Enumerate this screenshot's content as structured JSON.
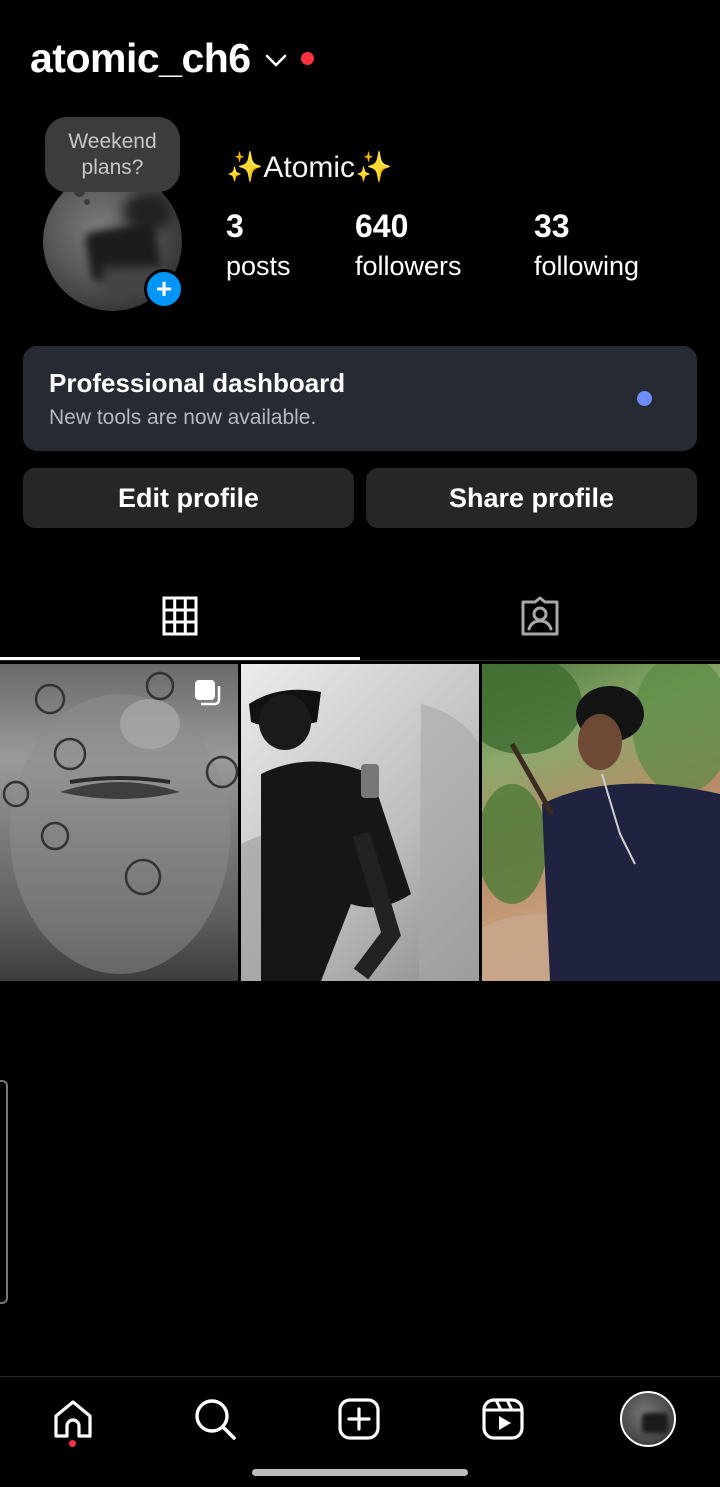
{
  "profile": {
    "username": "atomic_ch6",
    "display_name": "✨Atomic✨",
    "note_bubble": {
      "line1": "Weekend",
      "line2": "plans?"
    },
    "add_story_symbol": "+"
  },
  "stats": {
    "posts": {
      "value": "3",
      "label": "posts"
    },
    "followers": {
      "value": "640",
      "label": "followers"
    },
    "following": {
      "value": "33",
      "label": "following"
    }
  },
  "dashboard": {
    "title": "Professional dashboard",
    "subtitle": "New tools are now available."
  },
  "buttons": {
    "edit": "Edit profile",
    "share": "Share profile"
  },
  "tabs": [
    {
      "name": "grid",
      "icon": "grid-icon",
      "active": true
    },
    {
      "name": "tagged",
      "icon": "tagged-icon",
      "active": false
    }
  ],
  "posts": [
    {
      "type": "carousel",
      "icon": "multiple-images-icon"
    },
    {
      "type": "single"
    },
    {
      "type": "single"
    }
  ],
  "bottom_nav": [
    {
      "name": "home",
      "icon": "home-icon",
      "has_notification": true
    },
    {
      "name": "search",
      "icon": "search-icon"
    },
    {
      "name": "create",
      "icon": "add-post-icon"
    },
    {
      "name": "reels",
      "icon": "reels-icon"
    },
    {
      "name": "profile",
      "icon": "profile-avatar"
    }
  ],
  "colors": {
    "background": "#000000",
    "accent_blue": "#0095f6",
    "notification_red": "#ff3040",
    "dashboard_dot": "#6e8cf5",
    "card_background": "#262a33",
    "button_background": "#262626"
  }
}
